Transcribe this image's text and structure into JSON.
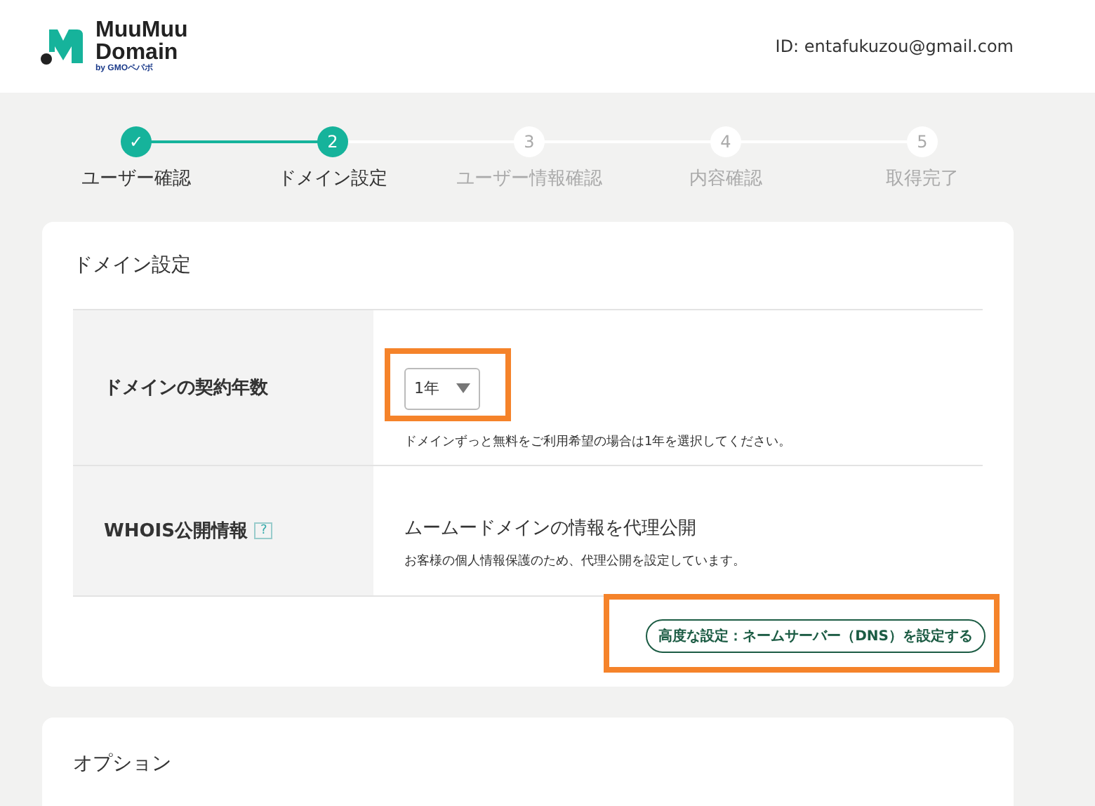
{
  "header": {
    "logo": {
      "line1": "MuuMuu",
      "line2": "Domain",
      "byline": "by GMOペパボ"
    },
    "account": "ID: entafukuzou@gmail.com"
  },
  "steps": [
    {
      "number": "✓",
      "label": "ユーザー確認",
      "reached": true
    },
    {
      "number": "2",
      "label": "ドメイン設定",
      "reached": true
    },
    {
      "number": "3",
      "label": "ユーザー情報確認",
      "reached": false
    },
    {
      "number": "4",
      "label": "内容確認",
      "reached": false
    },
    {
      "number": "5",
      "label": "取得完了",
      "reached": false
    }
  ],
  "domain_settings": {
    "title": "ドメイン設定",
    "rows": [
      {
        "kind": "select",
        "label": "ドメインの契約年数",
        "value": "1年",
        "highlighted": true,
        "note": "ドメインずっと無料をご利用希望の場合は1年を選択してください。"
      },
      {
        "kind": "info",
        "label": "WHOIS公開情報",
        "help": "?",
        "value": "ムームードメインの情報を代理公開",
        "note": "お客様の個人情報保護のため、代理公開を設定しています。"
      }
    ],
    "advanced_button": {
      "label": "高度な設定：ネームサーバー（DNS）を設定する",
      "highlighted": true
    }
  },
  "options": {
    "title": "オプション"
  }
}
